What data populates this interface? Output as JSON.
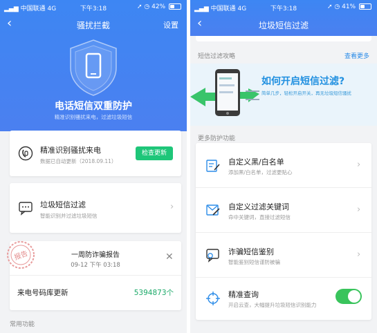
{
  "left": {
    "status": {
      "carrier": "中国联通",
      "network": "4G",
      "time": "下午3:18",
      "battery": "42%",
      "battery_level": 0.42
    },
    "nav": {
      "title": "骚扰拦截",
      "action": "设置"
    },
    "hero": {
      "title": "电话短信双重防护",
      "subtitle": "精准识别骚扰来电，过滤垃圾短信"
    },
    "cards": {
      "call_id": {
        "title": "精准识别骚扰来电",
        "sub": "数据已自动更新（2018.09.11）",
        "button": "检查更新"
      },
      "sms_filter": {
        "title": "垃圾短信过滤",
        "sub": "智能识别并过滤垃圾短信"
      },
      "report": {
        "title": "一周防诈骗报告",
        "date": "09-12 下午 03:18",
        "stamp": "报告"
      },
      "db": {
        "label": "来电号码库更新",
        "value": "5394873个"
      }
    },
    "section_common": "常用功能"
  },
  "right": {
    "status": {
      "carrier": "中国联通",
      "network": "4G",
      "time": "下午3:18",
      "battery": "41%",
      "battery_level": 0.41
    },
    "nav": {
      "title": "垃圾短信过滤"
    },
    "guide": {
      "label": "短信过滤攻略",
      "more": "查看更多"
    },
    "banner": {
      "title": "如何开启短信过滤?",
      "sub": "简单几步，轻松开启开关，再无垃圾短信骚扰"
    },
    "section_more": "更多防护功能",
    "items": [
      {
        "title": "自定义黑/白名单",
        "sub": "添加黑/白名单，过滤更贴心",
        "icon": "edit-list-icon"
      },
      {
        "title": "自定义过滤关键词",
        "sub": "命中关键词，直接过滤短信",
        "icon": "keyword-filter-icon"
      },
      {
        "title": "诈骗短信鉴别",
        "sub": "智能鉴别短信谨防被骗",
        "icon": "fraud-sms-icon"
      },
      {
        "title": "精准查询",
        "sub": "开启云查，大幅提升垃圾短信识别能力",
        "icon": "crosshair-icon",
        "toggle_on": true
      }
    ]
  },
  "colors": {
    "hero_blue": "#3d86f3",
    "accent_blue": "#2a8be8",
    "green": "#1ec679",
    "toggle_green": "#39c45c"
  }
}
